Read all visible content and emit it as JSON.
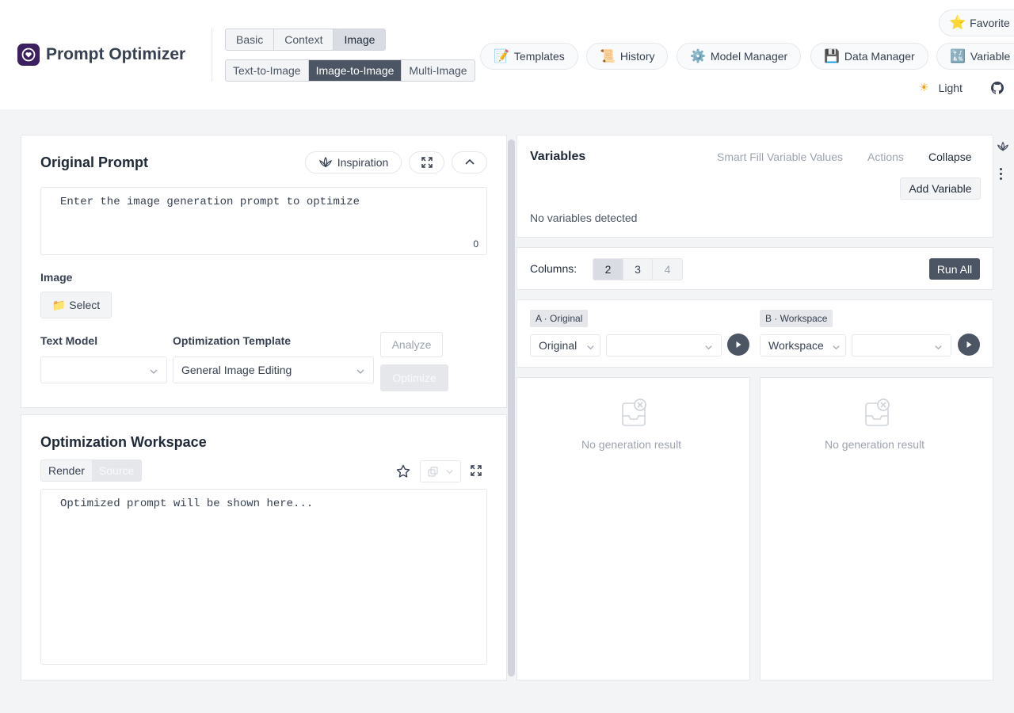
{
  "app": {
    "title": "Prompt Optimizer"
  },
  "mode_tabs": [
    {
      "label": "Basic",
      "active": false
    },
    {
      "label": "Context",
      "active": false
    },
    {
      "label": "Image",
      "active": true
    }
  ],
  "sub_tabs": [
    {
      "label": "Text-to-Image",
      "active": false
    },
    {
      "label": "Image-to-Image",
      "active": true
    },
    {
      "label": "Multi-Image",
      "active": false
    }
  ],
  "nav": {
    "templates": {
      "icon": "📝",
      "label": "Templates"
    },
    "history": {
      "icon": "📜",
      "label": "History"
    },
    "model_manager": {
      "icon": "⚙️",
      "label": "Model Manager"
    },
    "data_manager": {
      "icon": "💾",
      "label": "Data Manager"
    },
    "variable": {
      "icon": "🔣",
      "label": "Variable"
    },
    "favorite": {
      "icon": "⭐",
      "label": "Favorite"
    }
  },
  "theme": {
    "label": "Light"
  },
  "original_prompt": {
    "title": "Original Prompt",
    "inspiration_label": "Inspiration",
    "placeholder": "Enter the image generation prompt to optimize",
    "char_count": "0",
    "image_label": "Image",
    "select_icon": "📁",
    "select_label": "Select",
    "text_model_label": "Text Model",
    "text_model_value": "",
    "template_label": "Optimization Template",
    "template_value": "General Image Editing",
    "analyze_label": "Analyze",
    "optimize_label": "Optimize"
  },
  "workspace": {
    "title": "Optimization Workspace",
    "render_label": "Render",
    "source_label": "Source",
    "placeholder": "Optimized prompt will be shown here..."
  },
  "variables": {
    "title": "Variables",
    "smart_fill_label": "Smart Fill Variable Values",
    "actions_label": "Actions",
    "collapse_label": "Collapse",
    "add_variable_label": "Add Variable",
    "empty_text": "No variables detected"
  },
  "columns": {
    "label": "Columns:",
    "options": [
      "2",
      "3",
      "4"
    ],
    "selected": "2",
    "run_all_label": "Run All"
  },
  "compare": {
    "a": {
      "tag": "A · Original",
      "version": "Original",
      "model": ""
    },
    "b": {
      "tag": "B · Workspace",
      "version": "Workspace",
      "model": ""
    }
  },
  "results": {
    "a_empty": "No generation result",
    "b_empty": "No generation result"
  }
}
